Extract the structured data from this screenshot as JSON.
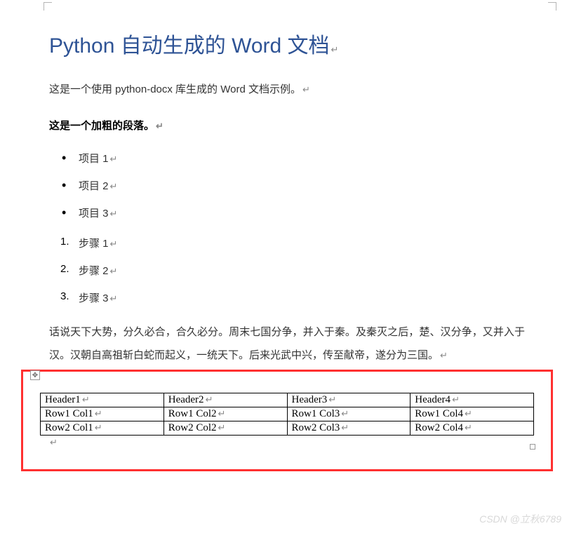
{
  "title": "Python 自动生成的 Word 文档",
  "paragraph1": "这是一个使用 python-docx 库生成的 Word 文档示例。",
  "paragraph_bold": "这是一个加粗的段落。",
  "bullets": [
    "项目 1",
    "项目 2",
    "项目 3"
  ],
  "steps": [
    "步骤 1",
    "步骤 2",
    "步骤 3"
  ],
  "long_text": "话说天下大势，分久必合，合久必分。周末七国分争，并入于秦。及秦灭之后，楚、汉分争，又并入于汉。汉朝自高祖斩白蛇而起义，一统天下。后来光武中兴，传至献帝，遂分为三国。",
  "table": {
    "headers": [
      "Header1",
      "Header2",
      "Header3",
      "Header4"
    ],
    "rows": [
      [
        "Row1 Col1",
        "Row1 Col2",
        "Row1 Col3",
        "Row1 Col4"
      ],
      [
        "Row2 Col1",
        "Row2 Col2",
        "Row2 Col3",
        "Row2 Col4"
      ]
    ]
  },
  "marks": {
    "paragraph": "↵",
    "move": "✥"
  },
  "watermark": "CSDN @立秋6789"
}
